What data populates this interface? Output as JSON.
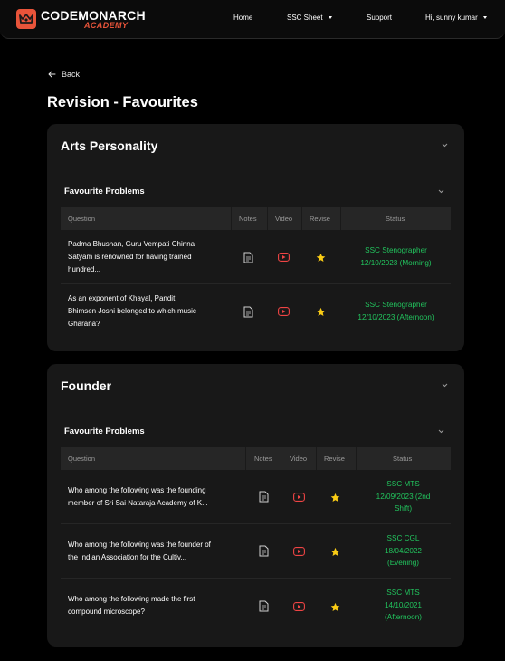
{
  "brand": {
    "name": "CODEMONARCH",
    "sub": "ACADEMY"
  },
  "nav": {
    "home": "Home",
    "ssc_sheet": "SSC Sheet",
    "support": "Support",
    "user": "Hi, sunny kumar"
  },
  "back_label": "Back",
  "page_title": "Revision - Favourites",
  "columns": {
    "question": "Question",
    "notes": "Notes",
    "video": "Video",
    "revise": "Revise",
    "status": "Status"
  },
  "colors": {
    "accent": "#e8543a",
    "status_green": "#22c55e",
    "video_red": "#ef4444",
    "star_yellow": "#facc15"
  },
  "sections": [
    {
      "title": "Arts Personality",
      "subtitle": "Favourite Problems",
      "rows": [
        {
          "question": [
            "Padma Bhushan, Guru Vempati Chinna",
            "Satyam is renowned for having trained",
            "hundred..."
          ],
          "status": [
            "SSC Stenographer",
            "12/10/2023 (Morning)"
          ]
        },
        {
          "question": [
            "As an exponent of Khayal, Pandit",
            "Bhimsen Joshi belonged to which music",
            "Gharana?"
          ],
          "status": [
            "SSC Stenographer",
            "12/10/2023 (Afternoon)"
          ]
        }
      ]
    },
    {
      "title": "Founder",
      "subtitle": "Favourite Problems",
      "rows": [
        {
          "question": [
            "Who among the following was the founding",
            "member of Sri Sai Nataraja Academy of K..."
          ],
          "status": [
            "SSC MTS",
            "12/09/2023 (2nd",
            "Shift)"
          ]
        },
        {
          "question": [
            "Who among the following was the founder of",
            "the Indian Association for the Cultiv..."
          ],
          "status": [
            "SSC CGL",
            "18/04/2022",
            "(Evening)"
          ]
        },
        {
          "question": [
            "Who among the following made the first",
            "compound microscope?"
          ],
          "status": [
            "SSC MTS",
            "14/10/2021",
            "(Afternoon)"
          ]
        }
      ]
    }
  ]
}
